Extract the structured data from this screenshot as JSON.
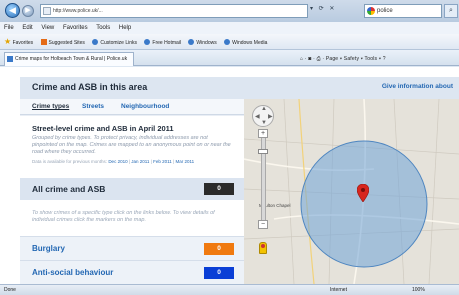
{
  "browser": {
    "url": "http://www.police.uk/...",
    "search_query": "police",
    "menu": [
      "File",
      "Edit",
      "View",
      "Favorites",
      "Tools",
      "Help"
    ],
    "favorites_label": "Favorites",
    "favorites_items": [
      "Suggested Sites",
      "Customize Links",
      "Free Hotmail",
      "Windows",
      "Windows Media"
    ],
    "tab_title": "Crime maps for Holbeach Town & Rural | Police.uk",
    "commands": [
      "Page",
      "Safety",
      "Tools"
    ],
    "status_done": "Done",
    "status_zone": "Internet",
    "status_zoom": "100%"
  },
  "page": {
    "title": "Crime and ASB in this area",
    "info_link": "Give information about",
    "subtabs": [
      "Crime types",
      "Streets",
      "Neighbourhood"
    ],
    "heading": "Street-level crime and ASB in April 2011",
    "description": "Grouped by crime types. To protect privacy, individual addresses are not pinpointed on the map. Crimes are mapped to an anonymous point on or near the road where they occurred.",
    "dates_prefix": "Data is available for previous months:",
    "dates": [
      "Dec 2010",
      "Jan 2011",
      "Feb 2011",
      "Mar 2011"
    ],
    "all_label": "All crime and ASB",
    "all_count": "0",
    "hint": "To show crimes of a specific type click on the links below. To view details of individual crimes click the markers on the map.",
    "categories": [
      {
        "label": "Burglary",
        "count": "0"
      },
      {
        "label": "Anti-social behaviour",
        "count": "0"
      }
    ]
  },
  "map": {
    "place_label": "Moulton Chapel"
  },
  "colors": {
    "accent_link": "#2468b3",
    "burglary": "#f07a10",
    "asb": "#0a3fd6",
    "all_count_bg": "#2b2b2b"
  }
}
